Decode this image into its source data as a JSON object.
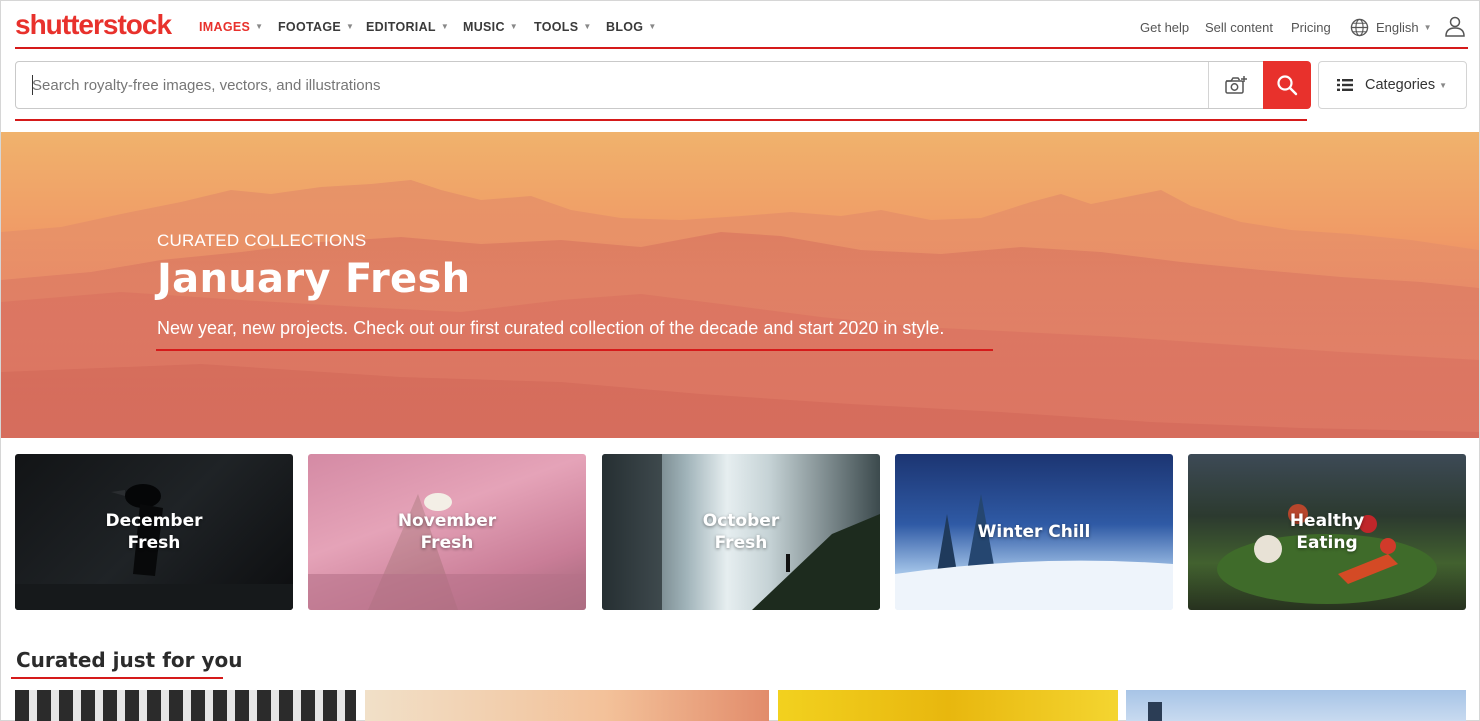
{
  "brand": {
    "logo_text": "shutterstock",
    "accent": "#e8312c",
    "underline": "#d51a1a"
  },
  "nav": {
    "items": [
      {
        "label": "IMAGES",
        "active": true
      },
      {
        "label": "FOOTAGE"
      },
      {
        "label": "EDITORIAL"
      },
      {
        "label": "MUSIC"
      },
      {
        "label": "TOOLS"
      },
      {
        "label": "BLOG"
      }
    ],
    "get_help": "Get help",
    "sell_content": "Sell content",
    "pricing": "Pricing",
    "language": "English",
    "icons": [
      "globe-icon",
      "user-icon",
      "chevron-down-icon"
    ]
  },
  "search": {
    "placeholder": "Search royalty-free images, vectors, and illustrations",
    "value": "",
    "icons": [
      "camera-search-icon",
      "search-icon"
    ]
  },
  "categories": {
    "label": "Categories",
    "icon": "list-icon"
  },
  "hero": {
    "eyebrow": "CURATED COLLECTIONS",
    "title": "January Fresh",
    "subtitle": "New year, new projects. Check out our first curated collection of the decade and start 2020 in style."
  },
  "collections": [
    {
      "label": "December\nFresh"
    },
    {
      "label": "November\nFresh"
    },
    {
      "label": "October\nFresh"
    },
    {
      "label": "Winter Chill"
    },
    {
      "label": "Healthy\nEating"
    }
  ],
  "curated": {
    "title": "Curated just for you"
  }
}
